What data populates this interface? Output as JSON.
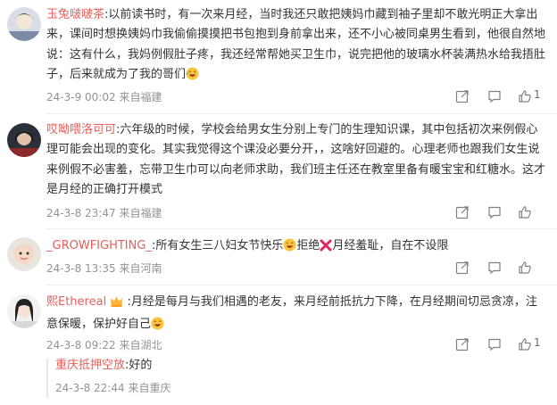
{
  "comments": [
    {
      "username": "玉兔啵啵茶",
      "text": ":以前读书时，有一次来月经，当时我还只敢把姨妈巾藏到袖子里却不敢光明正大拿出来，课间时想换姨妈巾我偷偷摸摸把书包抱到身前拿出来，还不小心被同桌男生看到，他很自然地说：这有什么，我妈例假肚子疼，我还经常帮她买卫生巾，说完把他的玻璃水杯装满热水给我捂肚子，后来就成为了我的哥们",
      "timestamp": "24-3-9 00:02",
      "location": "来自福建",
      "likes": "1"
    },
    {
      "username": "哎呦喂洛可可",
      "text": ":六年级的时候，学校会给男女生分别上专门的生理知识课，其中包括初次来例假心理可能会出现的变化。其实我觉得这个课没必要分开，，这啥好回避的。心理老师也跟我们女生说来例假不必害羞，忘带卫生巾可以向老师求助，我们班主任还在教室里备有暖宝宝和红糖水。这才是月经的正确打开模式",
      "timestamp": "24-3-8 23:47",
      "location": "来自福建",
      "likes": ""
    },
    {
      "username": "_GROWFIGHTING_",
      "text_a": ":所有女生三八妇女节快乐",
      "text_b": "拒绝",
      "text_c": "月经羞耻，自在不设限",
      "timestamp": "24-3-8 13:35",
      "location": "来自河南",
      "likes": ""
    },
    {
      "username": "熙Ethereal",
      "text": ":月经是每月与我们相遇的老友，来月经前抵抗力下降，在月经期间切忌贪凉，注意保暖，保护好自己",
      "timestamp": "24-3-8 09:22",
      "location": "来自湖北",
      "likes": "1"
    }
  ],
  "reply": {
    "username": "重庆抵押空放",
    "text": ":好的",
    "timestamp": "24-3-8 22:44",
    "location": "来自重庆"
  },
  "colors": {
    "username": "#e8605a",
    "meta": "#939393",
    "text": "#333333"
  },
  "icons": {
    "share": "share-icon",
    "comment": "comment-icon",
    "like": "thumbs-up-icon",
    "crown": "crown-icon",
    "laugh": "laughing-emoji-icon",
    "cross": "red-cross-icon"
  }
}
